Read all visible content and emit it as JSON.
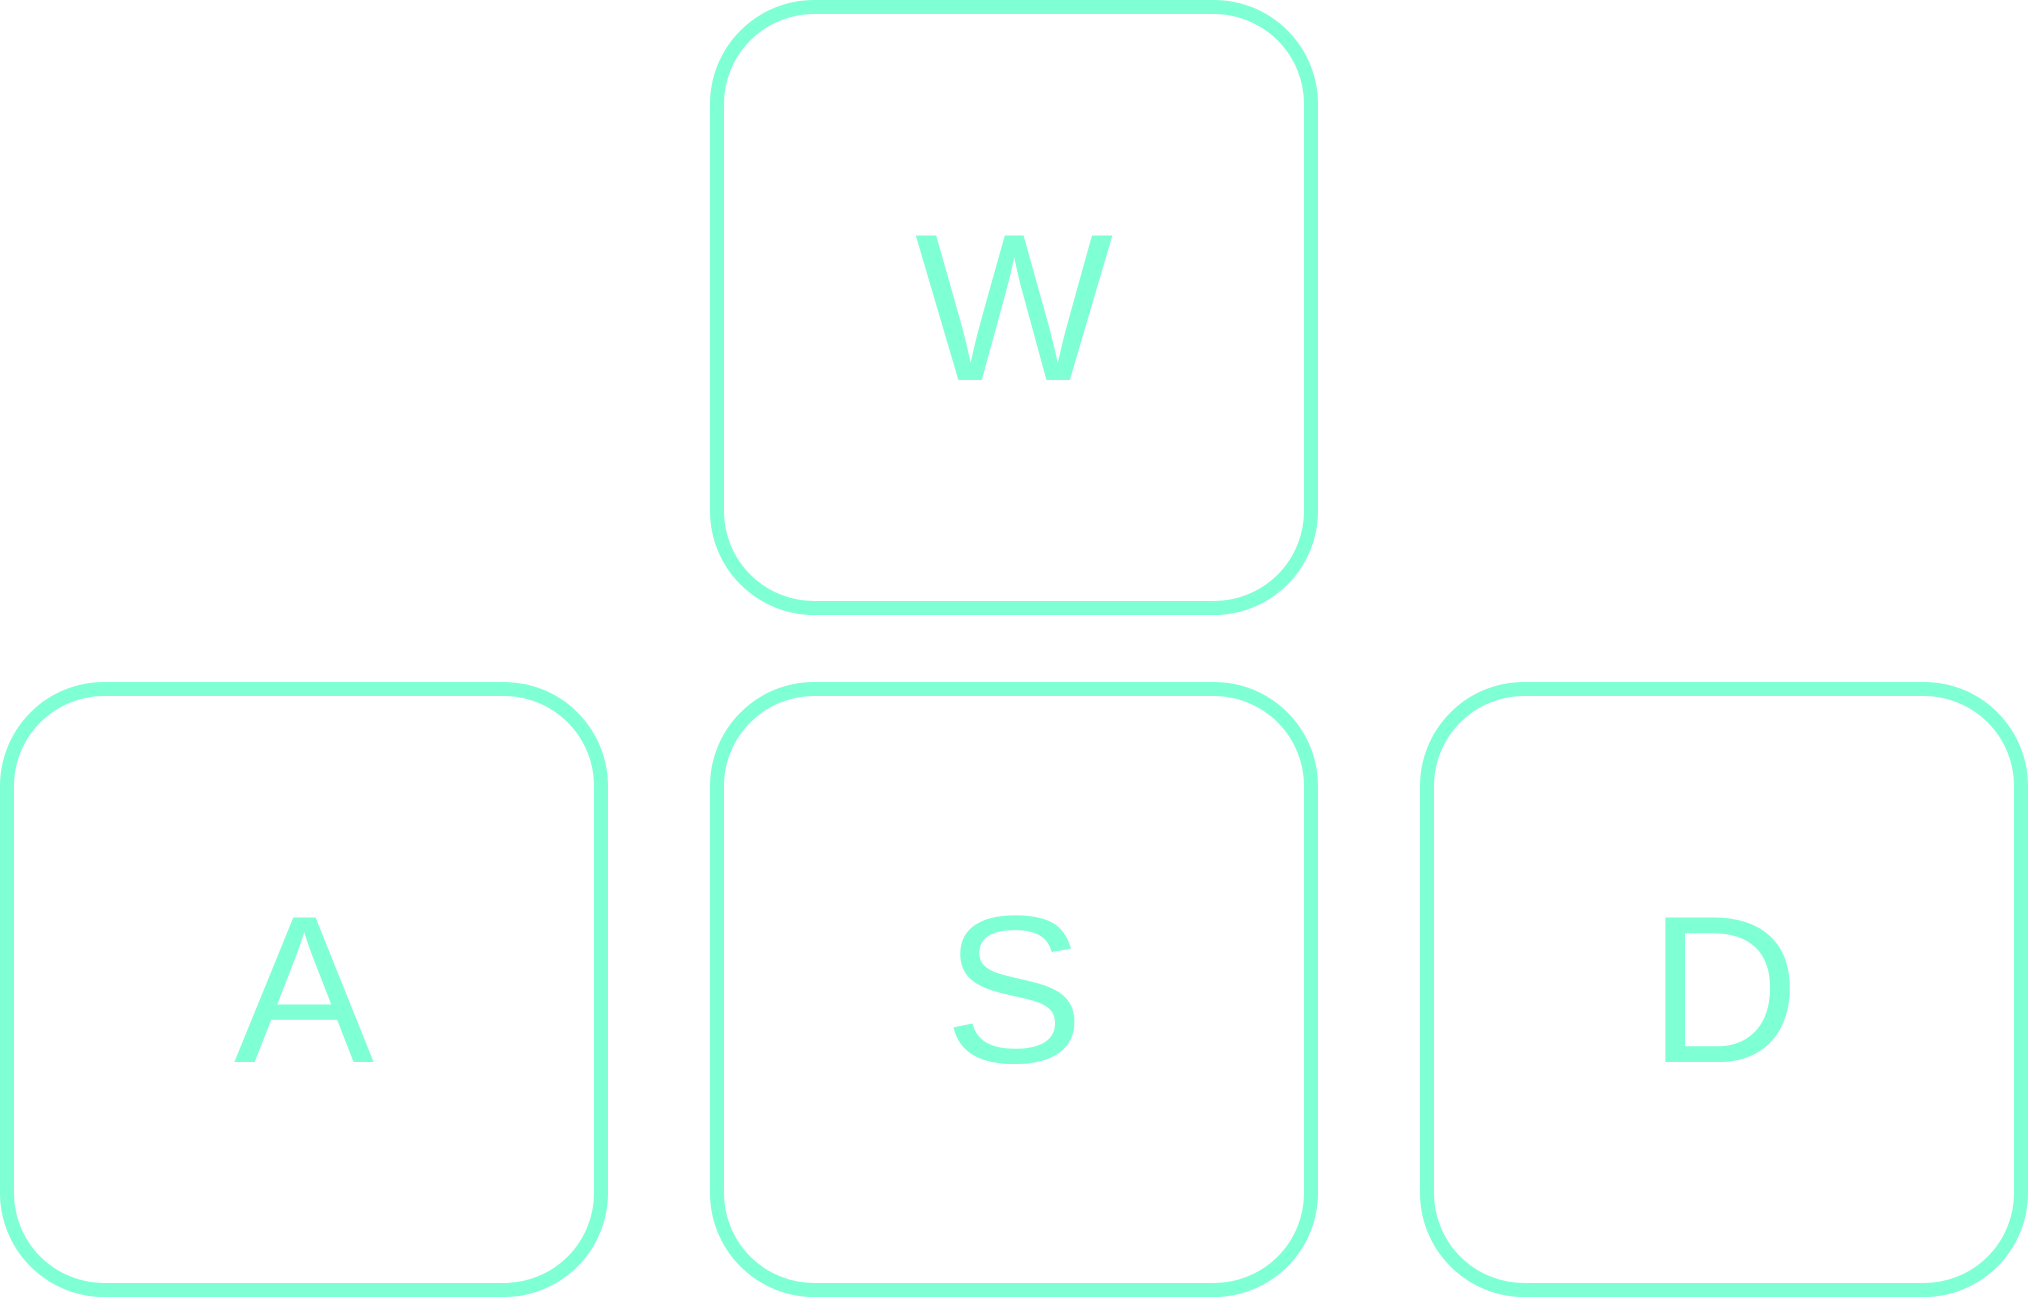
{
  "keys": {
    "w": {
      "label": "W"
    },
    "a": {
      "label": "A"
    },
    "s": {
      "label": "S"
    },
    "d": {
      "label": "D"
    }
  },
  "colors": {
    "accent": "#7fffd4",
    "background": "#ffffff"
  }
}
